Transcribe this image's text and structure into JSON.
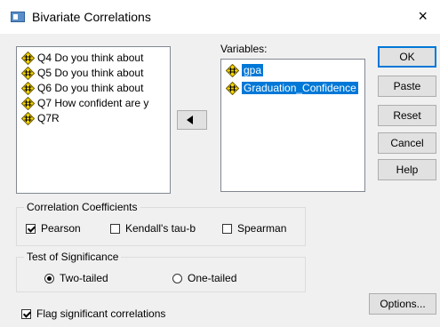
{
  "window": {
    "title": "Bivariate Correlations",
    "close_glyph": "×"
  },
  "source_list": {
    "items": [
      "Q4 Do you think about",
      "Q5 Do you think about",
      "Q6 Do you think about",
      "Q7 How confident are y",
      "Q7R"
    ],
    "icon": "scale-variable-icon"
  },
  "variables": {
    "label": "Variables:",
    "items": [
      "gpa",
      "Graduation_Confidence"
    ],
    "selected_color": "#0078d7"
  },
  "buttons": {
    "ok": "OK",
    "paste": "Paste",
    "reset": "Reset",
    "cancel": "Cancel",
    "help": "Help",
    "options": "Options..."
  },
  "correlation": {
    "group_label": "Correlation Coefficients",
    "pearson": {
      "label": "Pearson",
      "checked": true
    },
    "kendall": {
      "label": "Kendall's tau-b",
      "checked": false
    },
    "spearman": {
      "label": "Spearman",
      "checked": false
    }
  },
  "significance": {
    "group_label": "Test of Significance",
    "two_tailed": {
      "label": "Two-tailed",
      "selected": true
    },
    "one_tailed": {
      "label": "One-tailed",
      "selected": false
    }
  },
  "flag": {
    "label": "Flag significant correlations",
    "checked": true
  }
}
